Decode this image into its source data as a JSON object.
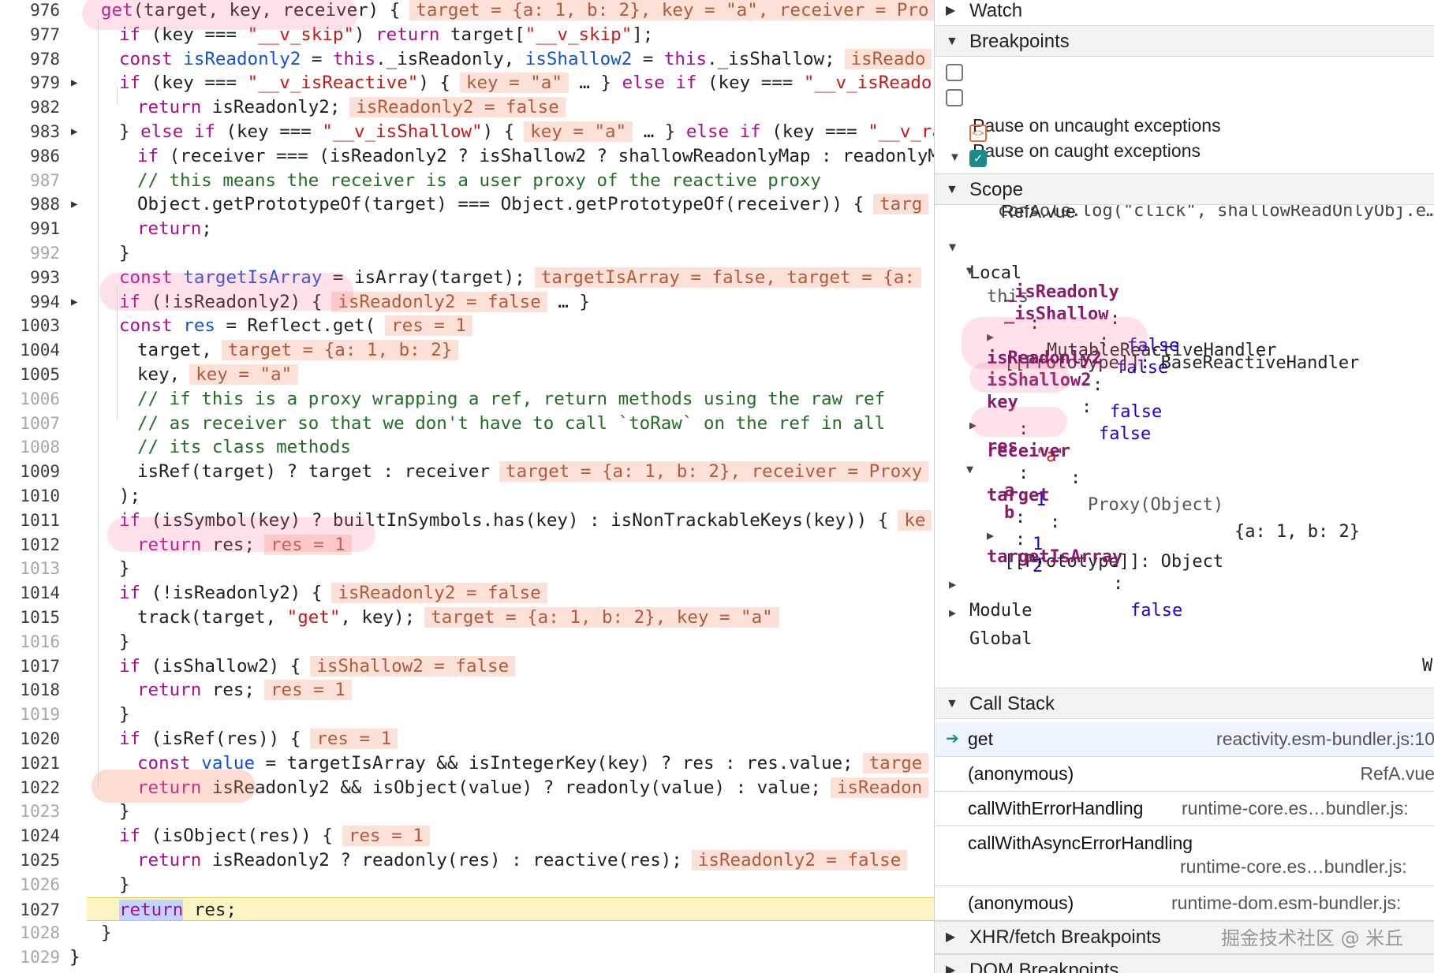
{
  "editor": {
    "lines": [
      {
        "n": "976",
        "faint": false,
        "expand": false,
        "current": false,
        "html": "<span class=\"kw\">get</span>(target, key, receiver) {<span class=\"inl\">target = {a: 1, b: 2}, key = \"a\", receiver = Pro</span>",
        "indent": 0
      },
      {
        "n": "977",
        "faint": false,
        "expand": false,
        "current": false,
        "html": "<span class=\"kw\">if</span> (key === <span class=\"str\">\"__v_skip\"</span>) <span class=\"kw\">return</span> target[<span class=\"str\">\"__v_skip\"</span>];",
        "indent": 1
      },
      {
        "n": "978",
        "faint": false,
        "expand": false,
        "current": false,
        "html": "<span class=\"kw\">const</span> <span class=\"decl\">isReadonly2</span> = <span class=\"kw\">this</span>._isReadonly, <span class=\"decl\">isShallow2</span> = <span class=\"kw\">this</span>._isShallow;<span class=\"inl\">isReado</span>",
        "indent": 1
      },
      {
        "n": "979",
        "faint": false,
        "expand": true,
        "current": false,
        "html": "<span class=\"kw\">if</span> (key === <span class=\"str\">\"__v_isReactive\"</span>) {<span class=\"inl\">key = \"a\"</span> … } <span class=\"kw\">else if</span> (key === <span class=\"str\">\"__v_isReador</span>",
        "indent": 1
      },
      {
        "n": "982",
        "faint": false,
        "expand": false,
        "current": false,
        "html": "<span class=\"kw\">return</span> isReadonly2;<span class=\"inl\">isReadonly2 = false</span>",
        "indent": 2
      },
      {
        "n": "983",
        "faint": false,
        "expand": true,
        "current": false,
        "html": "} <span class=\"kw\">else if</span> (key === <span class=\"str\">\"__v_isShallow\"</span>) {<span class=\"inl\">key = \"a\"</span> … } <span class=\"kw\">else if</span> (key === <span class=\"str\">\"__v_ra</span>",
        "indent": 1
      },
      {
        "n": "986",
        "faint": false,
        "expand": false,
        "current": false,
        "html": "<span class=\"kw\">if</span> (receiver === (isReadonly2 ? isShallow2 ? shallowReadonlyMap : readonlyM",
        "indent": 2
      },
      {
        "n": "987",
        "faint": true,
        "expand": false,
        "current": false,
        "html": "<span class=\"cm\">// this means the receiver is a user proxy of the reactive proxy</span>",
        "indent": 2
      },
      {
        "n": "988",
        "faint": false,
        "expand": true,
        "current": false,
        "html": "Object.getPrototypeOf(target) === Object.getPrototypeOf(receiver)) {<span class=\"inl\">targ</span>",
        "indent": 2
      },
      {
        "n": "991",
        "faint": false,
        "expand": false,
        "current": false,
        "html": "<span class=\"kw\">return</span>;",
        "indent": 2
      },
      {
        "n": "992",
        "faint": true,
        "expand": false,
        "current": false,
        "html": "}",
        "indent": 1
      },
      {
        "n": "993",
        "faint": false,
        "expand": false,
        "current": false,
        "html": "<span class=\"kw\">const</span> <span class=\"decl\">targetIsArray</span> = isArray(target);<span class=\"inl\">targetIsArray = false, target = {a:</span>",
        "indent": 1
      },
      {
        "n": "994",
        "faint": false,
        "expand": true,
        "current": false,
        "html": "<span class=\"kw\">if</span> (!isReadonly2) {<span class=\"inl\">isReadonly2 = false</span> … }",
        "indent": 1
      },
      {
        "n": "1003",
        "faint": false,
        "expand": false,
        "current": false,
        "html": "<span class=\"kw\">const</span> <span class=\"decl\">res</span> = Reflect.get(<span class=\"inl\">res = 1</span>",
        "indent": 1
      },
      {
        "n": "1004",
        "faint": false,
        "expand": false,
        "current": false,
        "html": "target,<span class=\"inl\">target = {a: 1, b: 2}</span>",
        "indent": 2
      },
      {
        "n": "1005",
        "faint": false,
        "expand": false,
        "current": false,
        "html": "key,<span class=\"inl\">key = \"a\"</span>",
        "indent": 2
      },
      {
        "n": "1006",
        "faint": true,
        "expand": false,
        "current": false,
        "html": "<span class=\"cm\">// if this is a proxy wrapping a ref, return methods using the raw ref</span>",
        "indent": 2
      },
      {
        "n": "1007",
        "faint": true,
        "expand": false,
        "current": false,
        "html": "<span class=\"cm\">// as receiver so that we don't have to call `toRaw` on the ref in all</span>",
        "indent": 2
      },
      {
        "n": "1008",
        "faint": true,
        "expand": false,
        "current": false,
        "html": "<span class=\"cm\">// its class methods</span>",
        "indent": 2
      },
      {
        "n": "1009",
        "faint": false,
        "expand": false,
        "current": false,
        "html": "isRef(target) ? target : receiver<span class=\"inl\">target = {a: 1, b: 2}, receiver = Proxy</span>",
        "indent": 2
      },
      {
        "n": "1010",
        "faint": false,
        "expand": false,
        "current": false,
        "html": ");",
        "indent": 1
      },
      {
        "n": "1011",
        "faint": false,
        "expand": false,
        "current": false,
        "html": "<span class=\"kw\">if</span> (isSymbol(key) ? builtInSymbols.has(key) : isNonTrackableKeys(key)) {<span class=\"inl\">ke</span>",
        "indent": 1
      },
      {
        "n": "1012",
        "faint": false,
        "expand": false,
        "current": false,
        "html": "<span class=\"kw\">return</span> res;<span class=\"inl\">res = 1</span>",
        "indent": 2
      },
      {
        "n": "1013",
        "faint": true,
        "expand": false,
        "current": false,
        "html": "}",
        "indent": 1
      },
      {
        "n": "1014",
        "faint": false,
        "expand": false,
        "current": false,
        "html": "<span class=\"kw\">if</span> (!isReadonly2) {<span class=\"inl\">isReadonly2 = false</span>",
        "indent": 1
      },
      {
        "n": "1015",
        "faint": false,
        "expand": false,
        "current": false,
        "html": "track(target, <span class=\"str\">\"get\"</span>, key);<span class=\"inl\">target = {a: 1, b: 2}, key = \"a\"</span>",
        "indent": 2
      },
      {
        "n": "1016",
        "faint": true,
        "expand": false,
        "current": false,
        "html": "}",
        "indent": 1
      },
      {
        "n": "1017",
        "faint": false,
        "expand": false,
        "current": false,
        "html": "<span class=\"kw\">if</span> (isShallow2) {<span class=\"inl\">isShallow2 = false</span>",
        "indent": 1
      },
      {
        "n": "1018",
        "faint": false,
        "expand": false,
        "current": false,
        "html": "<span class=\"kw\">return</span> res;<span class=\"inl\">res = 1</span>",
        "indent": 2
      },
      {
        "n": "1019",
        "faint": true,
        "expand": false,
        "current": false,
        "html": "}",
        "indent": 1
      },
      {
        "n": "1020",
        "faint": false,
        "expand": false,
        "current": false,
        "html": "<span class=\"kw\">if</span> (isRef(res)) {<span class=\"inl\">res = 1</span>",
        "indent": 1
      },
      {
        "n": "1021",
        "faint": false,
        "expand": false,
        "current": false,
        "html": "<span class=\"kw\">const</span> <span class=\"decl\">value</span> = targetIsArray &amp;&amp; isIntegerKey(key) ? res : res.value;<span class=\"inl\">targe</span>",
        "indent": 2
      },
      {
        "n": "1022",
        "faint": false,
        "expand": false,
        "current": false,
        "html": "<span class=\"kw\">return</span> isReadonly2 &amp;&amp; isObject(value) ? readonly(value) : value;<span class=\"inl\">isReadon</span>",
        "indent": 2
      },
      {
        "n": "1023",
        "faint": true,
        "expand": false,
        "current": false,
        "html": "}",
        "indent": 1
      },
      {
        "n": "1024",
        "faint": false,
        "expand": false,
        "current": false,
        "html": "<span class=\"kw\">if</span> (isObject(res)) {<span class=\"inl\">res = 1</span>",
        "indent": 1
      },
      {
        "n": "1025",
        "faint": false,
        "expand": false,
        "current": false,
        "html": "<span class=\"kw\">return</span> isReadonly2 ? readonly(res) : reactive(res);<span class=\"inl\">isReadonly2 = false</span>",
        "indent": 2
      },
      {
        "n": "1026",
        "faint": true,
        "expand": false,
        "current": false,
        "html": "}",
        "indent": 1
      },
      {
        "n": "1027",
        "faint": false,
        "expand": false,
        "current": true,
        "html": "<span class=\"kw sel\">return</span> res;",
        "indent": 1
      },
      {
        "n": "1028",
        "faint": true,
        "expand": false,
        "current": false,
        "html": "}",
        "indent": 0
      },
      {
        "n": "1029",
        "faint": true,
        "expand": false,
        "current": false,
        "html": "}",
        "indent": -1
      }
    ]
  },
  "sidebar": {
    "watch": "Watch",
    "breakpoints": "Breakpoints",
    "pause_uncaught": "Pause on uncaught exceptions",
    "pause_caught": "Pause on caught exceptions",
    "bp_file": "RefA.vue",
    "bp_code": "console.log(\"click\", shallowReadOnlyObj.e…",
    "scope": "Scope",
    "local": "Local",
    "this_label": "this",
    "this_value": "MutableReactiveHandler",
    "is_readonly_key": "_isReadonly",
    "is_readonly_val": "false",
    "is_shallow_key": "_isShallow",
    "is_shallow_val": "false",
    "proto1": "[[Prototype]]: BaseReactiveHandler",
    "isreadonly2_key": "isReadonly2",
    "isreadonly2_val": "false",
    "isshallow2_key": "isShallow2",
    "isshallow2_val": "false",
    "key_key": "key",
    "key_val": "\"a\"",
    "receiver_key": "receiver",
    "receiver_type": "Proxy(Object)",
    "receiver_val": "{a: 1, b: 2}",
    "res_key": "res",
    "res_val": "1",
    "target_key": "target",
    "a_key": "a",
    "a_val": "1",
    "b_key": "b",
    "b_val": "2",
    "proto2": "[[Prototype]]: Object",
    "tia_key": "targetIsArray",
    "tia_val": "false",
    "module": "Module",
    "global": "Global",
    "global_right": "W",
    "call_stack": "Call Stack",
    "frames": [
      {
        "fn": "get",
        "loc": "reactivity.esm-bundler.js:10"
      },
      {
        "fn": "(anonymous)",
        "loc": "RefA.vue"
      },
      {
        "fn": "callWithErrorHandling",
        "loc": "runtime-core.es…bundler.js:"
      },
      {
        "fn": "callWithAsyncErrorHandling",
        "loc": "runtime-core.es…bundler.js:"
      },
      {
        "fn": "(anonymous)",
        "loc": "runtime-dom.esm-bundler.js:"
      }
    ],
    "xhr": "XHR/fetch Breakpoints",
    "dom": "DOM Breakpoints"
  },
  "watermark": "掘金技术社区 @ 米丘",
  "colors": {
    "keyword": "#aa0d91",
    "string": "#c41a16",
    "inline_value_bg": "#fbe1d7",
    "current_line_bg": "#fdf5c4",
    "highlight_marker": "rgba(255,120,160,0.22)",
    "scope_key": "#8a1a6a",
    "scope_value": "#1c00cf"
  }
}
